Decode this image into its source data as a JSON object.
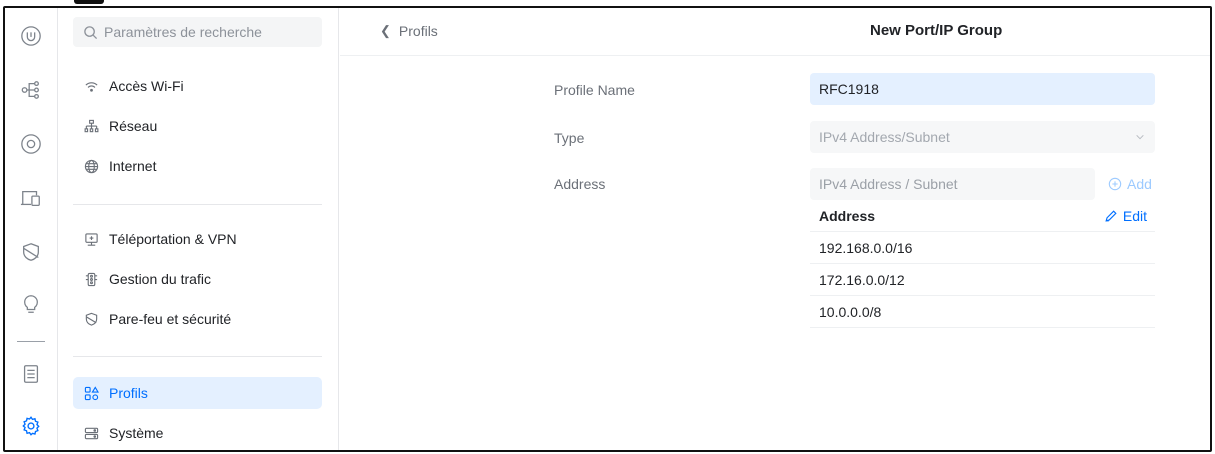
{
  "rail": {
    "icons": [
      "ubiquiti-logo-icon",
      "topology-icon",
      "devices-icon",
      "client-devices-icon",
      "shield-icon",
      "insights-icon",
      "system-log-icon",
      "settings-icon"
    ]
  },
  "sidebar": {
    "search_placeholder": "Paramètres de recherche",
    "groups": [
      [
        {
          "label": "Accès Wi-Fi",
          "icon": "wifi-icon"
        },
        {
          "label": "Réseau",
          "icon": "network-icon"
        },
        {
          "label": "Internet",
          "icon": "globe-icon"
        }
      ],
      [
        {
          "label": "Téléportation & VPN",
          "icon": "vpn-icon"
        },
        {
          "label": "Gestion du trafic",
          "icon": "traffic-icon"
        },
        {
          "label": "Pare-feu et sécurité",
          "icon": "shield-icon"
        }
      ],
      [
        {
          "label": "Profils",
          "icon": "profiles-icon",
          "active": true
        },
        {
          "label": "Système",
          "icon": "system-icon"
        }
      ]
    ]
  },
  "header": {
    "back_label": "Profils",
    "title": "New Port/IP Group"
  },
  "form": {
    "profile_name_label": "Profile Name",
    "profile_name_value": "RFC1918",
    "type_label": "Type",
    "type_value": "IPv4 Address/Subnet",
    "address_label": "Address",
    "address_placeholder": "IPv4 Address / Subnet",
    "add_label": "Add",
    "table_header": "Address",
    "edit_label": "Edit",
    "addresses": [
      "192.168.0.0/16",
      "172.16.0.0/12",
      "10.0.0.0/8"
    ]
  },
  "colors": {
    "accent": "#006fff",
    "active_bg": "#e4f0ff"
  }
}
